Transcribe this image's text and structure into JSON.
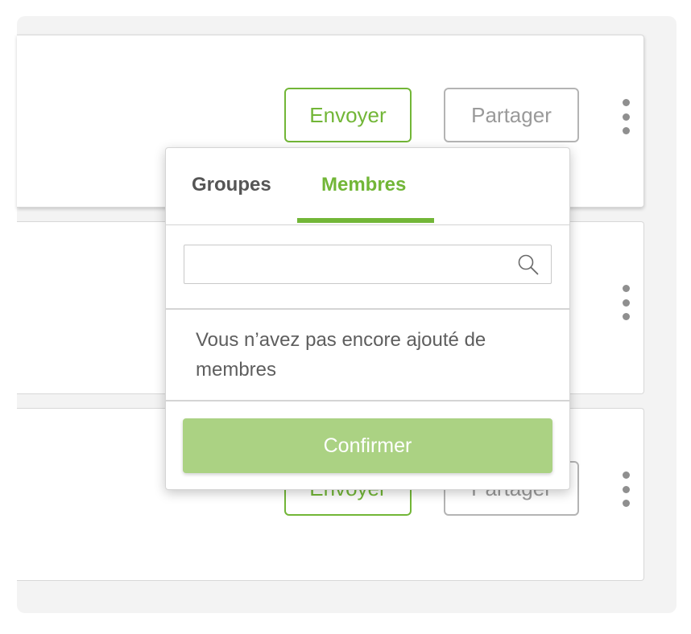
{
  "cards": [
    {
      "send_label": "Envoyer",
      "share_label": "Partager"
    },
    {
      "send_label": "",
      "share_label": ""
    },
    {
      "send_label": "Envoyer",
      "share_label": "Partager"
    }
  ],
  "popover": {
    "tabs": {
      "groups": "Groupes",
      "members": "Membres",
      "active": "Membres"
    },
    "search": {
      "value": "",
      "placeholder": ""
    },
    "empty_message": "Vous n’avez pas encore ajouté de membres",
    "confirm_label": "Confirmer"
  },
  "colors": {
    "accent": "#72b637",
    "confirm_bg": "#abd283",
    "secondary_border": "#b4b4b4"
  },
  "icons": {
    "search": "search-icon",
    "more": "more-vertical-icon"
  }
}
